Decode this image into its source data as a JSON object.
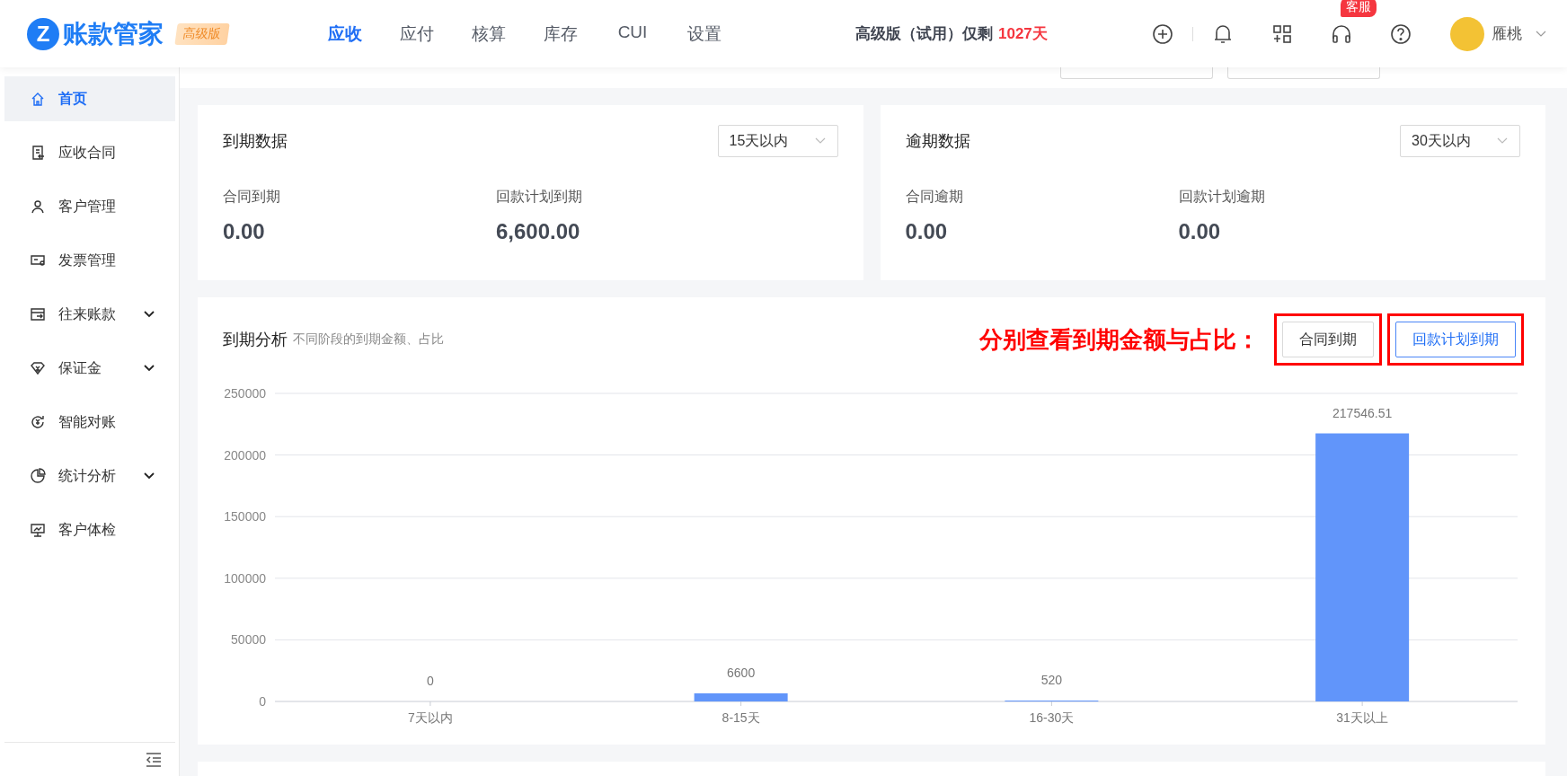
{
  "logo": {
    "mark": "Z",
    "name": "账款管家",
    "badge": "高级版"
  },
  "nav": [
    {
      "label": "应收",
      "selected": true
    },
    {
      "label": "应付",
      "selected": false
    },
    {
      "label": "核算",
      "selected": false
    },
    {
      "label": "库存",
      "selected": false
    },
    {
      "label": "CUI",
      "selected": false
    },
    {
      "label": "设置",
      "selected": false
    }
  ],
  "trial": {
    "text": "高级版（试用）仅剩",
    "days": "1027天"
  },
  "support_badge": "客服",
  "user": {
    "name": "雁桃"
  },
  "sidebar": {
    "items": [
      {
        "label": "首页",
        "kind": "link",
        "selected": true
      },
      {
        "label": "应收合同",
        "kind": "link",
        "selected": false
      },
      {
        "label": "客户管理",
        "kind": "link",
        "selected": false
      },
      {
        "label": "发票管理",
        "kind": "link",
        "selected": false
      },
      {
        "label": "往来账款",
        "kind": "group",
        "selected": false
      },
      {
        "label": "保证金",
        "kind": "group",
        "selected": false
      },
      {
        "label": "智能对账",
        "kind": "link",
        "selected": false
      },
      {
        "label": "统计分析",
        "kind": "group",
        "selected": false
      },
      {
        "label": "客户体检",
        "kind": "link",
        "selected": false
      }
    ]
  },
  "summary_cards": [
    {
      "title": "到期数据",
      "range": "15天以内",
      "metrics": [
        {
          "label": "合同到期",
          "value": "0.00"
        },
        {
          "label": "回款计划到期",
          "value": "6,600.00"
        }
      ]
    },
    {
      "title": "逾期数据",
      "range": "30天以内",
      "metrics": [
        {
          "label": "合同逾期",
          "value": "0.00"
        },
        {
          "label": "回款计划逾期",
          "value": "0.00"
        }
      ]
    }
  ],
  "analysis": {
    "title": "到期分析",
    "subtitle": "不同阶段的到期金额、占比",
    "annotation": "分别查看到期金额与占比：",
    "toggles": [
      {
        "label": "合同到期",
        "selected": false
      },
      {
        "label": "回款计划到期",
        "selected": true
      }
    ],
    "chart_data": {
      "type": "bar",
      "categories": [
        "7天以内",
        "8-15天",
        "16-30天",
        "31天以上"
      ],
      "series": [
        {
          "color": "#6195fa",
          "values": [
            0,
            6600,
            520,
            217546.51
          ]
        }
      ],
      "grid": true,
      "ylim": [
        0,
        250000
      ],
      "yticks": [
        0,
        50000,
        100000,
        150000,
        200000,
        250000
      ],
      "data_labels": true
    }
  }
}
